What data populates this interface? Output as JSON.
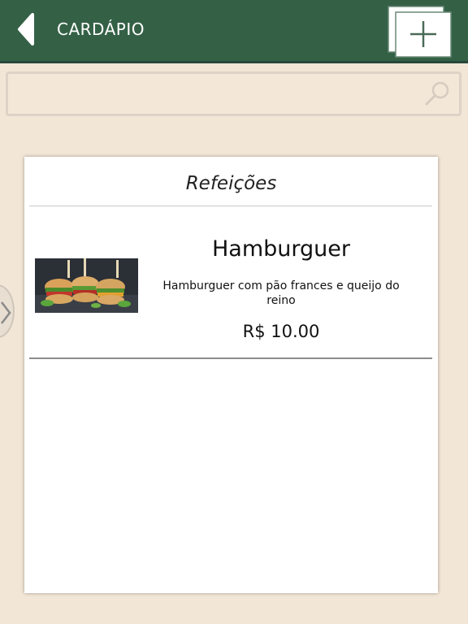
{
  "header": {
    "title": "CARDÁPIO",
    "background_color": "#346146",
    "back_icon": "back-arrow-icon",
    "add_icon": "add-icon"
  },
  "search": {
    "value": "",
    "placeholder": "",
    "icon": "search-icon"
  },
  "side_handle": {
    "icon": "chevron-right-icon"
  },
  "menu": {
    "section_title": "Refeições",
    "items": [
      {
        "name": "Hamburguer",
        "description": "Hamburguer com pão frances e queijo do reino",
        "price": "R$ 10.00",
        "image": "hamburger-photo"
      }
    ]
  }
}
